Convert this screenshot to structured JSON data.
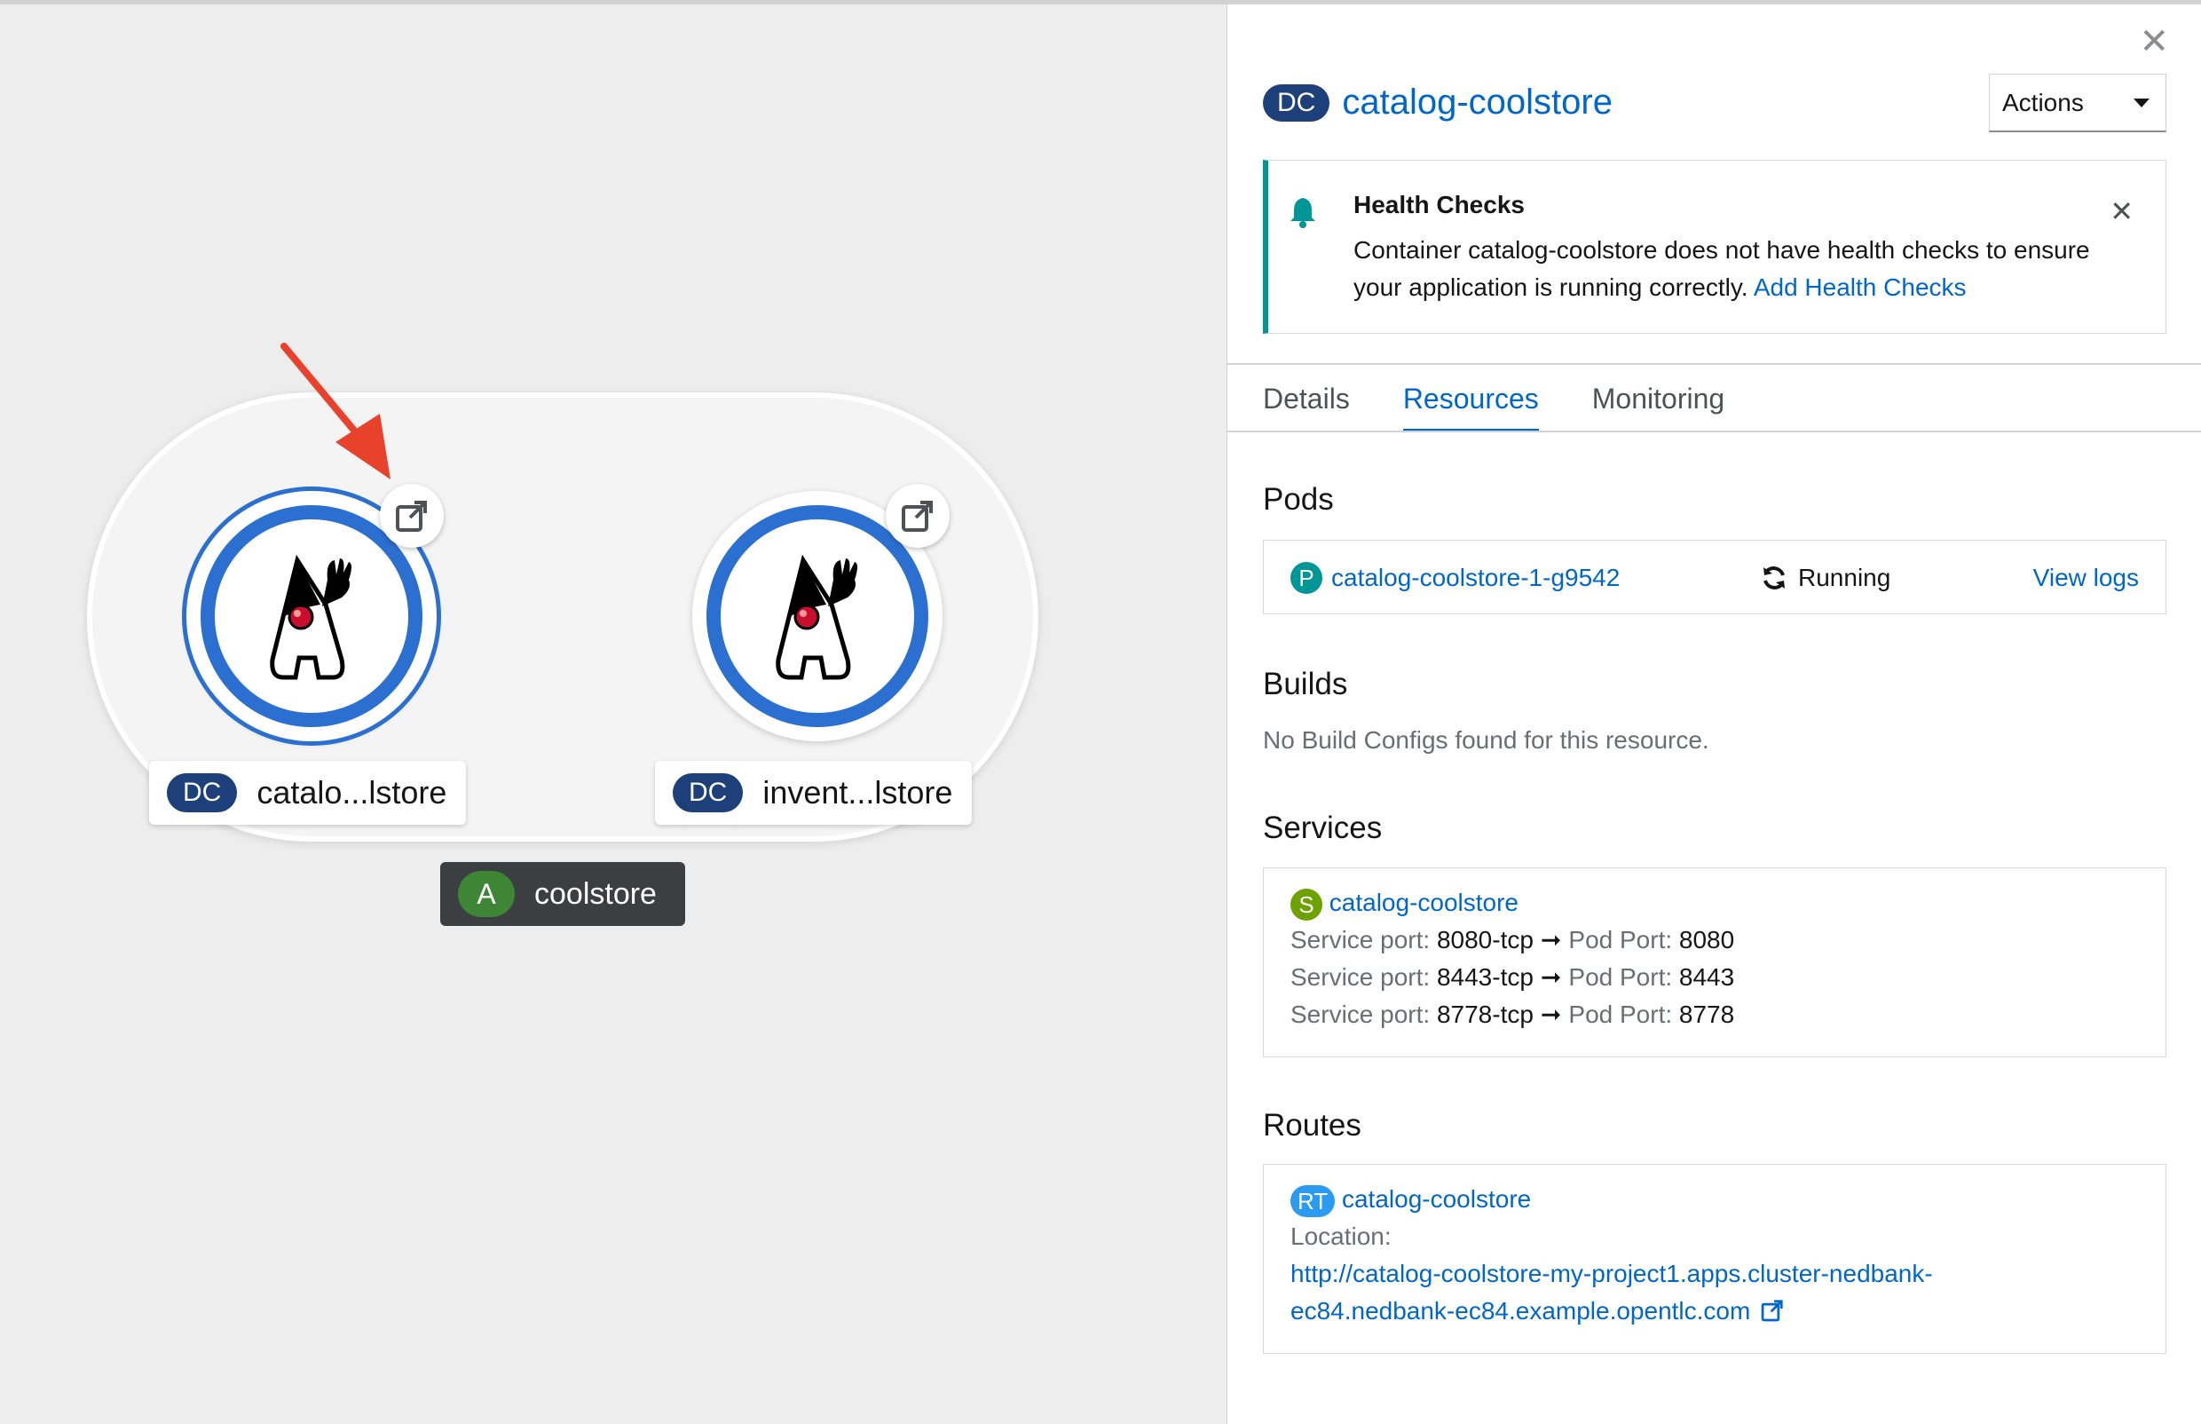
{
  "topology": {
    "nodes": [
      {
        "kind_badge": "DC",
        "label": "catalo...lstore",
        "selected": true
      },
      {
        "kind_badge": "DC",
        "label": "invent...lstore",
        "selected": false
      }
    ],
    "application": {
      "badge": "A",
      "label": "coolstore"
    },
    "icons": [
      "java-duke-icon",
      "external-link-icon",
      "annotation-arrow"
    ]
  },
  "panel": {
    "kind_badge": "DC",
    "name": "catalog-coolstore",
    "actions_label": "Actions",
    "alert": {
      "title": "Health Checks",
      "body": "Container catalog-coolstore does not have health checks to ensure your application is running correctly.",
      "link": "Add Health Checks"
    },
    "tabs": [
      "Details",
      "Resources",
      "Monitoring"
    ],
    "active_tab": "Resources",
    "pods": {
      "title": "Pods",
      "badge": "P",
      "name": "catalog-coolstore-1-g9542",
      "status": "Running",
      "logs_link": "View logs"
    },
    "builds": {
      "title": "Builds",
      "empty": "No Build Configs found for this resource."
    },
    "services": {
      "title": "Services",
      "badge": "S",
      "name": "catalog-coolstore",
      "service_port_label": "Service port:",
      "pod_port_label": "Pod Port:",
      "ports": [
        {
          "service": "8080-tcp",
          "pod": "8080"
        },
        {
          "service": "8443-tcp",
          "pod": "8443"
        },
        {
          "service": "8778-tcp",
          "pod": "8778"
        }
      ]
    },
    "routes": {
      "title": "Routes",
      "badge": "RT",
      "name": "catalog-coolstore",
      "location_label": "Location:",
      "url_line1": "http://catalog-coolstore-my-project1.apps.cluster-nedbank-",
      "url_line2": "ec84.nedbank-ec84.example.opentlc.com"
    },
    "colors": {
      "link": "#0066cc",
      "dc_badge": "#1d3f7a",
      "app_badge": "#3e8635",
      "pod_badge": "#009596",
      "service_badge": "#6ca100",
      "route_badge": "#2b9af3",
      "alert_border": "#009596"
    }
  }
}
